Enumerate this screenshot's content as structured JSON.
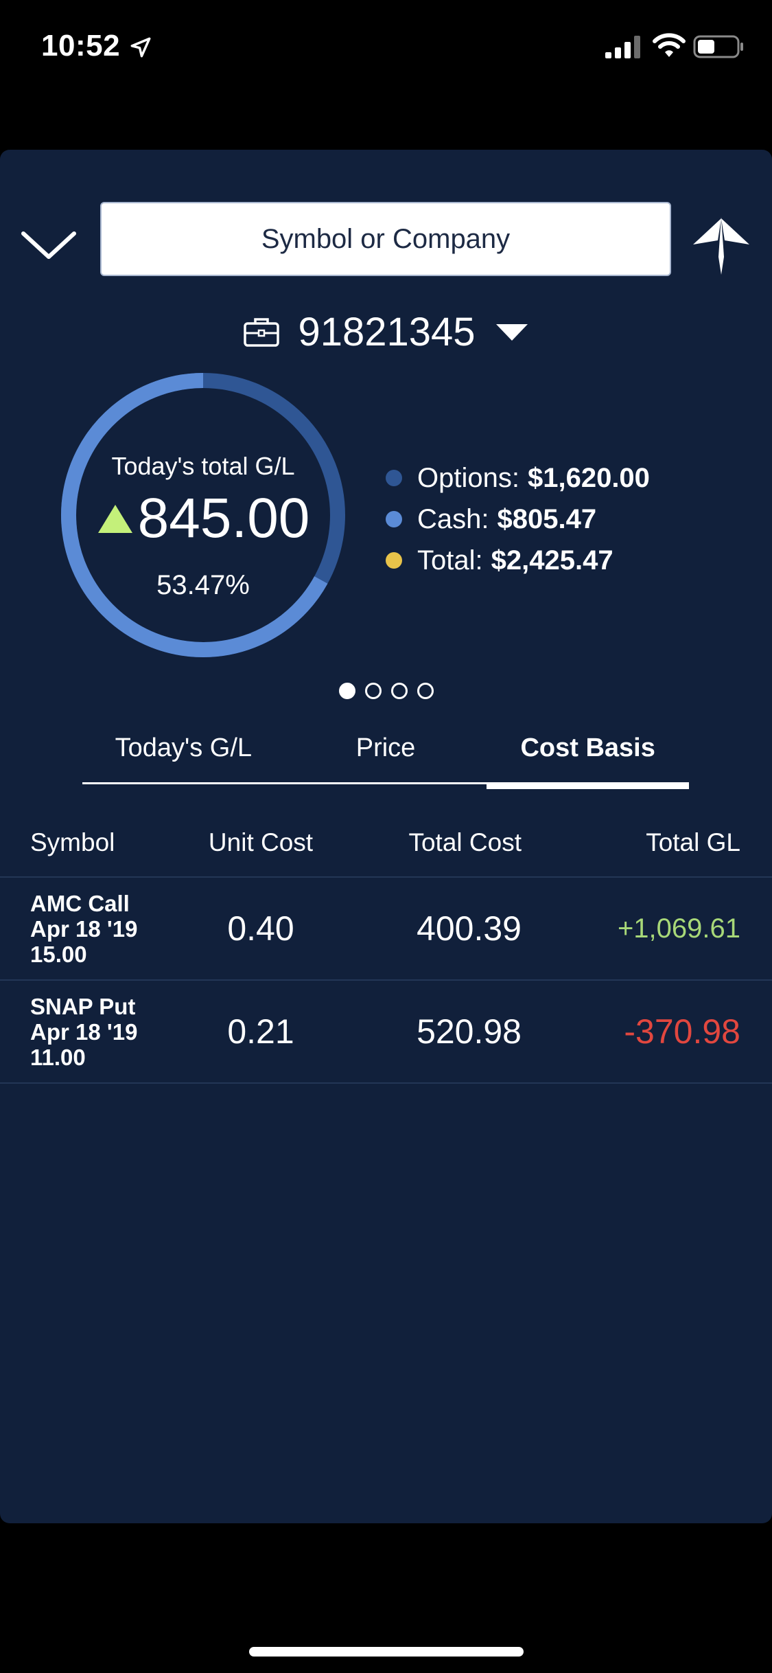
{
  "status_bar": {
    "time": "10:52"
  },
  "search": {
    "placeholder": "Symbol or Company"
  },
  "account": {
    "number": "91821345"
  },
  "summary": {
    "label": "Today's total G/L",
    "value": "845.00",
    "percent": "53.47%",
    "direction": "up",
    "donut_fill_fraction": 0.67,
    "colors": {
      "primary": "#5b8bd6",
      "secondary": "#2f5694",
      "up": "#c4f07a"
    }
  },
  "legend": [
    {
      "label": "Options:",
      "value": "$1,620.00",
      "color": "#2f5694"
    },
    {
      "label": "Cash:",
      "value": "$805.47",
      "color": "#5b8bd6"
    },
    {
      "label": "Total:",
      "value": "$2,425.47",
      "color": "#e8c34a"
    }
  ],
  "pager": {
    "count": 4,
    "active": 0
  },
  "tabs": [
    {
      "label": "Today's G/L",
      "active": false
    },
    {
      "label": "Price",
      "active": false
    },
    {
      "label": "Cost Basis",
      "active": true
    }
  ],
  "table": {
    "headers": {
      "symbol": "Symbol",
      "unit_cost": "Unit Cost",
      "total_cost": "Total Cost",
      "total_gl": "Total GL"
    },
    "rows": [
      {
        "line1": "AMC Call",
        "line2": "Apr 18 '19",
        "line3": "15.00",
        "unit_cost": "0.40",
        "total_cost": "400.39",
        "total_gl": "+1,069.61",
        "gl_sign": "positive"
      },
      {
        "line1": "SNAP Put",
        "line2": "Apr 18 '19",
        "line3": "11.00",
        "unit_cost": "0.21",
        "total_cost": "520.98",
        "total_gl": "-370.98",
        "gl_sign": "negative"
      }
    ]
  }
}
